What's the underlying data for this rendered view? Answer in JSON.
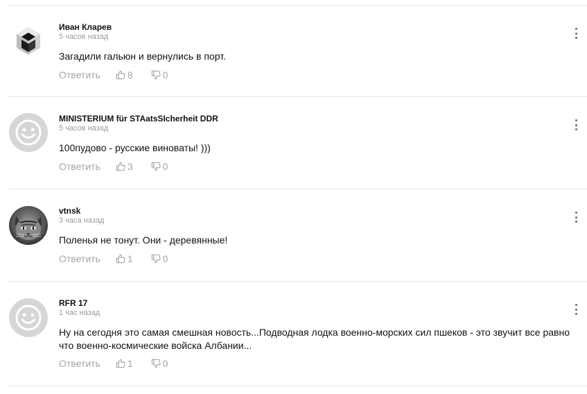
{
  "comments": [
    {
      "author": "Иван Кларев",
      "time": "5 часов назад",
      "text": "Загадили гальюн и вернулись в порт.",
      "reply": "Ответить",
      "likes": "8",
      "dislikes": "0",
      "avatar": "cube-logo-avatar"
    },
    {
      "author": "MINISTERIUM für STAatsSIcherheit DDR",
      "time": "5 часов назад",
      "text": "100пудово - русские виноваты! )))",
      "reply": "Ответить",
      "likes": "3",
      "dislikes": "0",
      "avatar": "default-smiley-avatar"
    },
    {
      "author": "vtnsk",
      "time": "3 часа назад",
      "text": "Поленья не тонут. Они - деревянные!",
      "reply": "Ответить",
      "likes": "1",
      "dislikes": "0",
      "avatar": "cat-photo-avatar"
    },
    {
      "author": "RFR 17",
      "time": "1 час назад",
      "text": "Ну на сегодня это самая смешная новость...Подводная лодка военно-морских сил пшеков - это звучит все равно что военно-космические войска Албании...",
      "reply": "Ответить",
      "likes": "1",
      "dislikes": "0",
      "avatar": "default-smiley-avatar"
    }
  ],
  "colors": {
    "meta": "#9a9a9a",
    "action": "#a5a5a5",
    "divider": "#e4e4e4",
    "avatar_default": "#d6d6d6"
  }
}
